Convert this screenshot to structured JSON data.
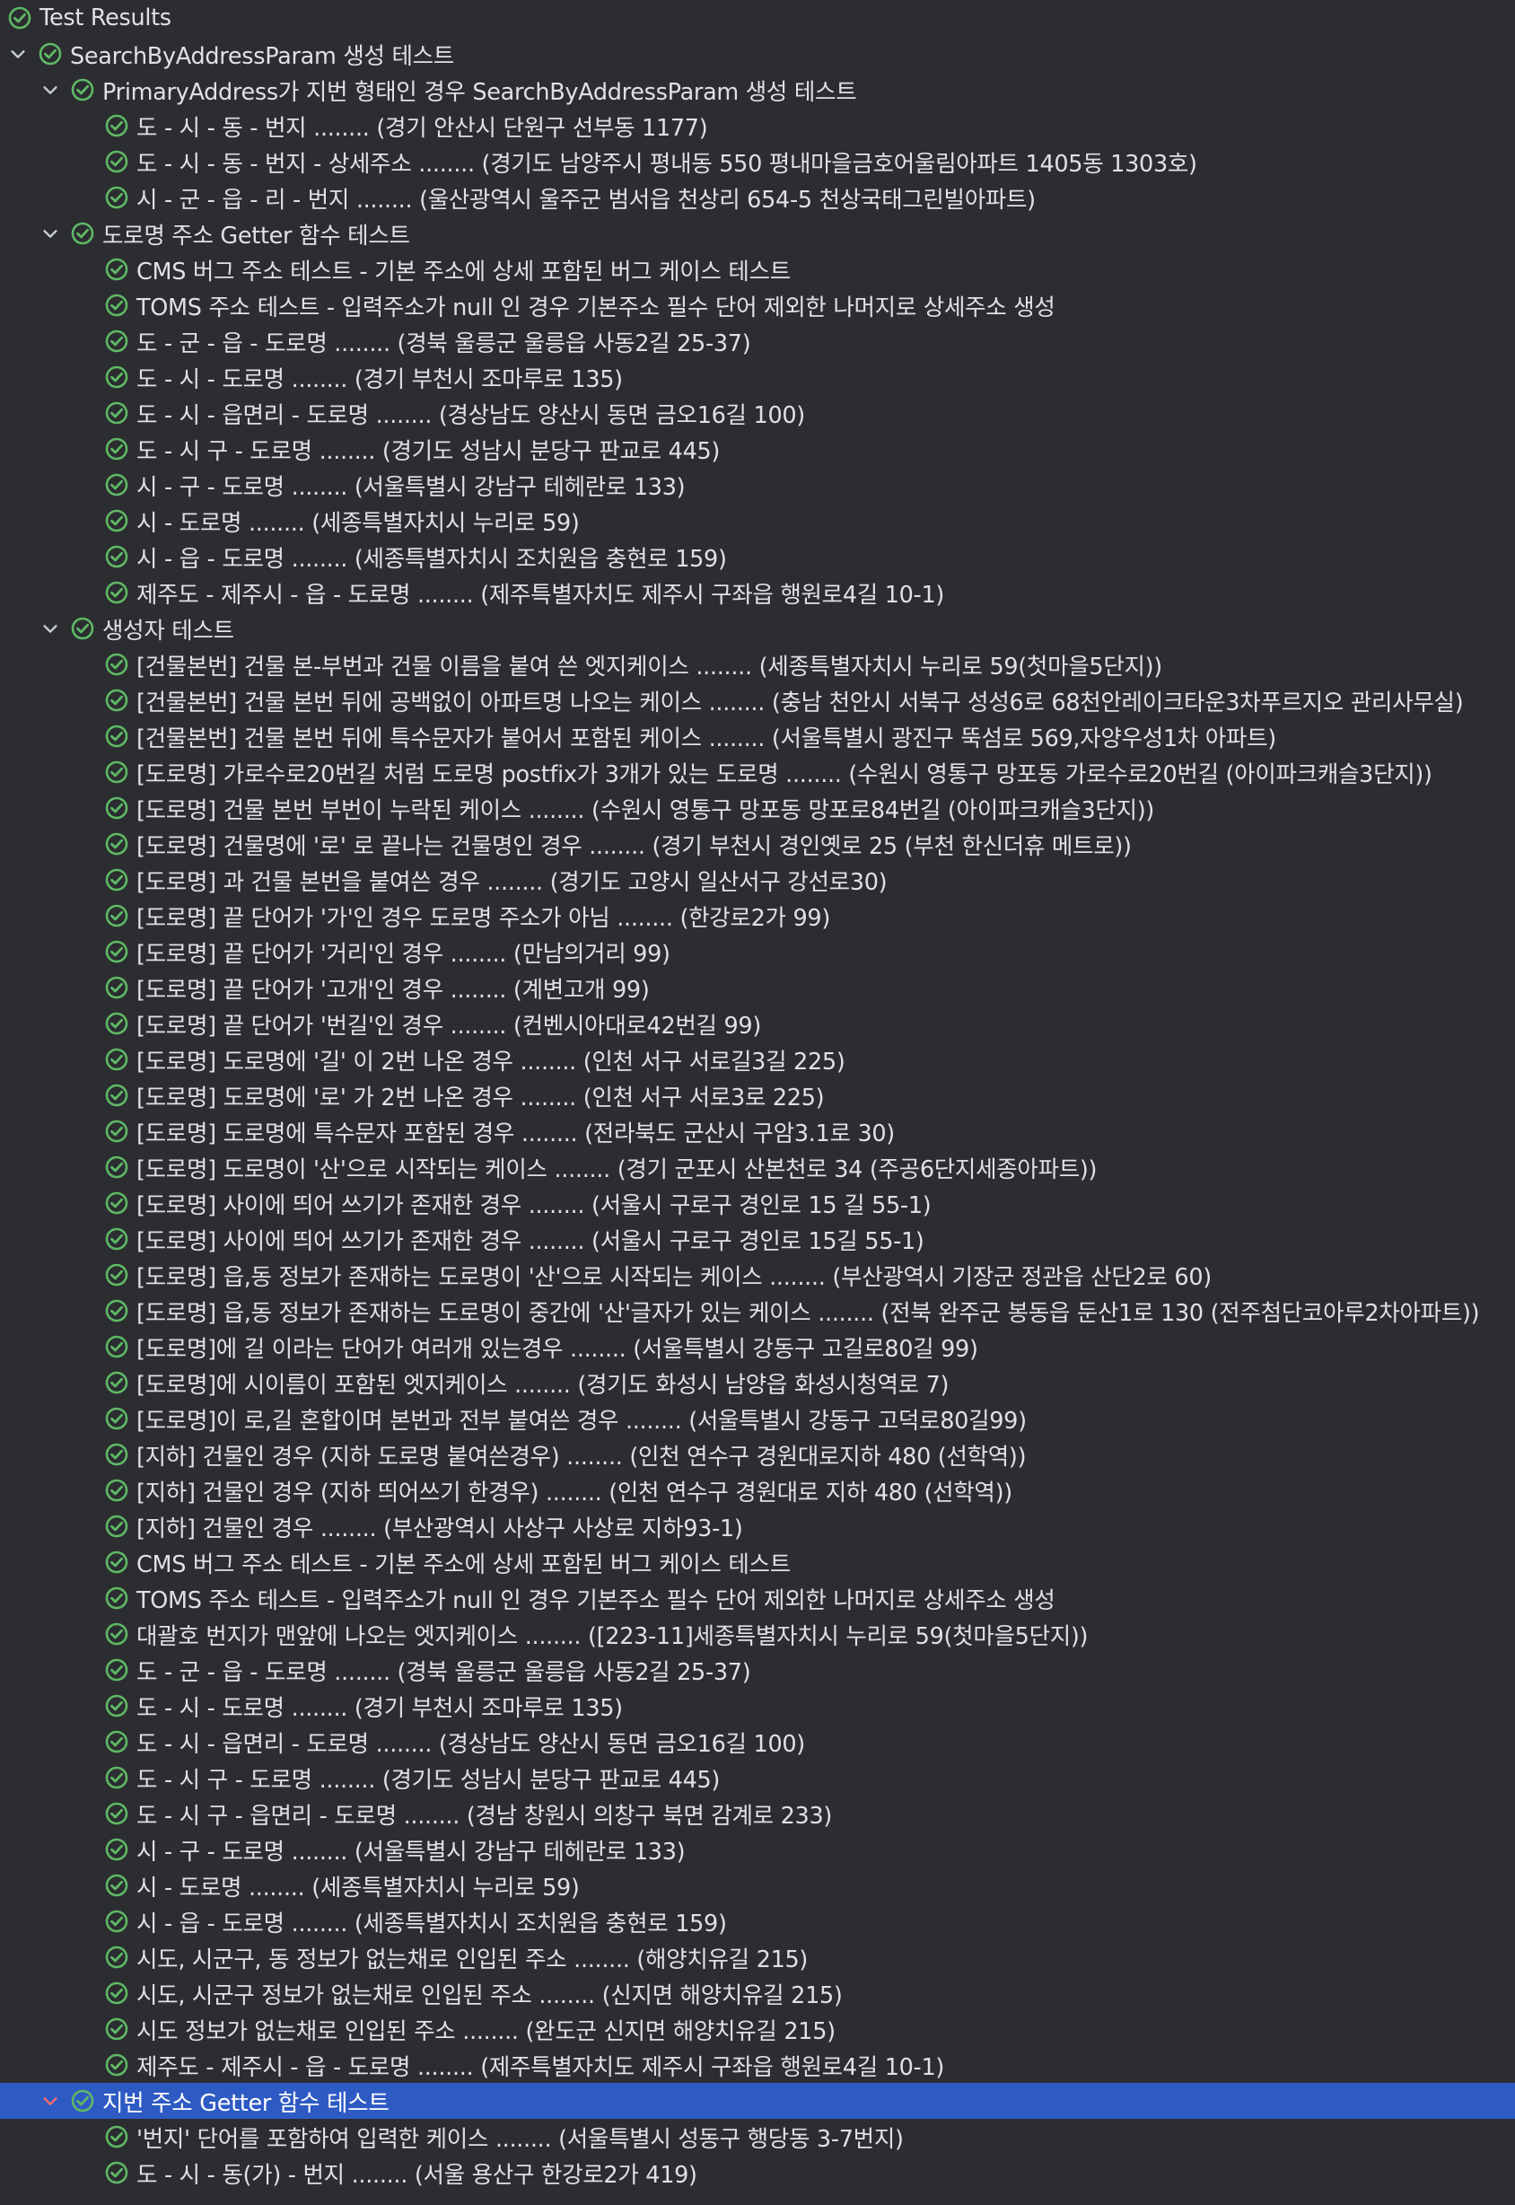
{
  "panel": {
    "title": "Test Results",
    "status_icon": "test-passed-icon",
    "colors": {
      "background": "#2b2d30",
      "text": "#dfe1e5",
      "passed": "#5fb865",
      "selection": "#2e5ac4",
      "chevron": "#c9ccd1"
    }
  },
  "rows": [
    {
      "level": 0,
      "kind": "root",
      "expanded": null,
      "label": "Test Results"
    },
    {
      "level": 1,
      "kind": "suite",
      "expanded": true,
      "label": "SearchByAddressParam 생성 테스트"
    },
    {
      "level": 2,
      "kind": "suite",
      "expanded": true,
      "label": "PrimaryAddress가 지번 형태인 경우 SearchByAddressParam 생성 테스트"
    },
    {
      "level": 3,
      "kind": "test",
      "label": "도 - 시 - 동 - 번지 ........ (경기 안산시 단원구 선부동 1177)"
    },
    {
      "level": 3,
      "kind": "test",
      "label": "도 - 시 - 동 - 번지 - 상세주소 ........ (경기도 남양주시 평내동 550 평내마을금호어울림아파트 1405동 1303호)"
    },
    {
      "level": 3,
      "kind": "test",
      "label": "시 - 군 - 읍 - 리 - 번지 ........ (울산광역시 울주군 범서읍 천상리 654-5 천상국태그린빌아파트)"
    },
    {
      "level": 2,
      "kind": "suite",
      "expanded": true,
      "label": "도로명 주소 Getter 함수 테스트"
    },
    {
      "level": 3,
      "kind": "test",
      "label": "CMS 버그 주소 테스트 - 기본 주소에 상세 포함된 버그 케이스 테스트"
    },
    {
      "level": 3,
      "kind": "test",
      "label": "TOMS 주소 테스트 - 입력주소가 null 인 경우 기본주소 필수 단어 제외한 나머지로 상세주소 생성"
    },
    {
      "level": 3,
      "kind": "test",
      "label": "도 - 군 - 읍 - 도로명 ........ (경북 울릉군 울릉읍 사동2길 25-37)"
    },
    {
      "level": 3,
      "kind": "test",
      "label": "도 - 시 - 도로명 ........ (경기 부천시 조마루로 135)"
    },
    {
      "level": 3,
      "kind": "test",
      "label": "도 - 시 - 읍면리 - 도로명 ........ (경상남도 양산시 동면 금오16길 100)"
    },
    {
      "level": 3,
      "kind": "test",
      "label": "도 - 시 구 - 도로명 ........ (경기도 성남시 분당구 판교로 445)"
    },
    {
      "level": 3,
      "kind": "test",
      "label": "시 - 구 - 도로명 ........ (서울특별시 강남구 테헤란로 133)"
    },
    {
      "level": 3,
      "kind": "test",
      "label": "시 - 도로명 ........ (세종특별자치시 누리로 59)"
    },
    {
      "level": 3,
      "kind": "test",
      "label": "시 - 읍 - 도로명 ........ (세종특별자치시 조치원읍 충현로 159)"
    },
    {
      "level": 3,
      "kind": "test",
      "label": "제주도 - 제주시 - 읍 - 도로명 ........ (제주특별자치도 제주시 구좌읍 행원로4길 10-1)"
    },
    {
      "level": 2,
      "kind": "suite",
      "expanded": true,
      "label": "생성자 테스트"
    },
    {
      "level": 3,
      "kind": "test",
      "label": "[건물본번] 건물 본-부번과 건물 이름을 붙여 쓴 엣지케이스 ........ (세종특별자치시 누리로 59(첫마을5단지))"
    },
    {
      "level": 3,
      "kind": "test",
      "label": "[건물본번] 건물 본번 뒤에 공백없이 아파트명 나오는 케이스 ........ (충남 천안시 서북구 성성6로 68천안레이크타운3차푸르지오 관리사무실)"
    },
    {
      "level": 3,
      "kind": "test",
      "label": "[건물본번] 건물 본번 뒤에 특수문자가 붙어서 포함된 케이스 ........ (서울특별시 광진구 뚝섬로 569,자양우성1차 아파트)"
    },
    {
      "level": 3,
      "kind": "test",
      "label": "[도로명] 가로수로20번길 처럼 도로명 postfix가 3개가 있는 도로명 ........ (수원시 영통구 망포동 가로수로20번길 (아이파크캐슬3단지))"
    },
    {
      "level": 3,
      "kind": "test",
      "label": "[도로명] 건물 본번 부번이 누락된 케이스 ........ (수원시 영통구 망포동 망포로84번길 (아이파크캐슬3단지))"
    },
    {
      "level": 3,
      "kind": "test",
      "label": "[도로명] 건물명에 '로' 로 끝나는 건물명인 경우 ........ (경기 부천시 경인옛로 25 (부천 한신더휴 메트로))"
    },
    {
      "level": 3,
      "kind": "test",
      "label": "[도로명] 과 건물 본번을 붙여쓴 경우 ........ (경기도 고양시 일산서구 강선로30)"
    },
    {
      "level": 3,
      "kind": "test",
      "label": "[도로명] 끝 단어가 '가'인 경우 도로명 주소가 아님 ........ (한강로2가 99)"
    },
    {
      "level": 3,
      "kind": "test",
      "label": "[도로명] 끝 단어가 '거리'인 경우 ........ (만남의거리 99)"
    },
    {
      "level": 3,
      "kind": "test",
      "label": "[도로명] 끝 단어가 '고개'인 경우 ........ (계변고개 99)"
    },
    {
      "level": 3,
      "kind": "test",
      "label": "[도로명] 끝 단어가 '번길'인 경우 ........ (컨벤시아대로42번길 99)"
    },
    {
      "level": 3,
      "kind": "test",
      "label": "[도로명] 도로명에 '길' 이 2번 나온 경우 ........ (인천 서구 서로길3길 225)"
    },
    {
      "level": 3,
      "kind": "test",
      "label": "[도로명] 도로명에 '로' 가 2번 나온 경우 ........ (인천 서구 서로3로 225)"
    },
    {
      "level": 3,
      "kind": "test",
      "label": "[도로명] 도로명에 특수문자 포함된 경우 ........ (전라북도 군산시 구암3.1로 30)"
    },
    {
      "level": 3,
      "kind": "test",
      "label": "[도로명] 도로명이 '산'으로 시작되는 케이스 ........ (경기 군포시 산본천로 34 (주공6단지세종아파트))"
    },
    {
      "level": 3,
      "kind": "test",
      "label": "[도로명] 사이에 띄어 쓰기가 존재한 경우 ........ (서울시 구로구 경인로 15 길 55-1)"
    },
    {
      "level": 3,
      "kind": "test",
      "label": "[도로명] 사이에 띄어 쓰기가 존재한 경우 ........ (서울시 구로구 경인로 15길 55-1)"
    },
    {
      "level": 3,
      "kind": "test",
      "label": "[도로명] 읍,동 정보가 존재하는 도로명이 '산'으로 시작되는 케이스 ........ (부산광역시 기장군 정관읍 산단2로 60)"
    },
    {
      "level": 3,
      "kind": "test",
      "label": "[도로명] 읍,동 정보가 존재하는 도로명이 중간에 '산'글자가 있는 케이스 ........ (전북 완주군 봉동읍 둔산1로 130 (전주첨단코아루2차아파트))"
    },
    {
      "level": 3,
      "kind": "test",
      "label": "[도로명]에 길 이라는 단어가 여러개 있는경우 ........ (서울특별시 강동구 고길로80길 99)"
    },
    {
      "level": 3,
      "kind": "test",
      "label": "[도로명]에 시이름이 포함된 엣지케이스 ........ (경기도 화성시 남양읍 화성시청역로 7)"
    },
    {
      "level": 3,
      "kind": "test",
      "label": "[도로명]이 로,길 혼합이며 본번과 전부 붙여쓴 경우 ........ (서울특별시 강동구 고덕로80길99)"
    },
    {
      "level": 3,
      "kind": "test",
      "label": "[지하] 건물인 경우 (지하 도로명 붙여쓴경우) ........ (인천 연수구 경원대로지하 480 (선학역))"
    },
    {
      "level": 3,
      "kind": "test",
      "label": "[지하] 건물인 경우 (지하 띄어쓰기 한경우) ........ (인천 연수구 경원대로 지하 480 (선학역))"
    },
    {
      "level": 3,
      "kind": "test",
      "label": "[지하] 건물인 경우 ........ (부산광역시 사상구 사상로 지하93-1)"
    },
    {
      "level": 3,
      "kind": "test",
      "label": "CMS 버그 주소 테스트 - 기본 주소에 상세 포함된 버그 케이스 테스트"
    },
    {
      "level": 3,
      "kind": "test",
      "label": "TOMS 주소 테스트 - 입력주소가 null 인 경우 기본주소 필수 단어 제외한 나머지로 상세주소 생성"
    },
    {
      "level": 3,
      "kind": "test",
      "label": "대괄호 번지가 맨앞에 나오는 엣지케이스 ........ ([223-11]세종특별자치시 누리로 59(첫마을5단지))"
    },
    {
      "level": 3,
      "kind": "test",
      "label": "도 - 군 - 읍 - 도로명 ........ (경북 울릉군 울릉읍 사동2길 25-37)"
    },
    {
      "level": 3,
      "kind": "test",
      "label": "도 - 시 - 도로명 ........ (경기 부천시 조마루로 135)"
    },
    {
      "level": 3,
      "kind": "test",
      "label": "도 - 시 - 읍면리 - 도로명 ........ (경상남도 양산시 동면 금오16길 100)"
    },
    {
      "level": 3,
      "kind": "test",
      "label": "도 - 시 구 - 도로명 ........ (경기도 성남시 분당구 판교로 445)"
    },
    {
      "level": 3,
      "kind": "test",
      "label": "도 - 시 구 - 읍면리 - 도로명 ........ (경남 창원시 의창구 북면 감계로 233)"
    },
    {
      "level": 3,
      "kind": "test",
      "label": "시 - 구 - 도로명 ........ (서울특별시 강남구 테헤란로 133)"
    },
    {
      "level": 3,
      "kind": "test",
      "label": "시 - 도로명 ........ (세종특별자치시 누리로 59)"
    },
    {
      "level": 3,
      "kind": "test",
      "label": "시 - 읍 - 도로명 ........ (세종특별자치시 조치원읍 충현로 159)"
    },
    {
      "level": 3,
      "kind": "test",
      "label": "시도, 시군구, 동 정보가 없는채로 인입된 주소 ........ (해양치유길 215)"
    },
    {
      "level": 3,
      "kind": "test",
      "label": "시도, 시군구 정보가 없는채로 인입된 주소 ........ (신지면 해양치유길 215)"
    },
    {
      "level": 3,
      "kind": "test",
      "label": "시도 정보가 없는채로 인입된 주소 ........ (완도군 신지면 해양치유길 215)"
    },
    {
      "level": 3,
      "kind": "test",
      "label": "제주도 - 제주시 - 읍 - 도로명 ........ (제주특별자치도 제주시 구좌읍 행원로4길 10-1)"
    },
    {
      "level": 2,
      "kind": "suite",
      "expanded": true,
      "selected": true,
      "label": "지번 주소 Getter 함수 테스트"
    },
    {
      "level": 3,
      "kind": "test",
      "label": "'번지' 단어를 포함하여 입력한 케이스 ........ (서울특별시 성동구 행당동 3-7번지)"
    },
    {
      "level": 3,
      "kind": "test",
      "label": "도 - 시 - 동(가) - 번지 ........ (서울 용산구 한강로2가 419)"
    }
  ]
}
